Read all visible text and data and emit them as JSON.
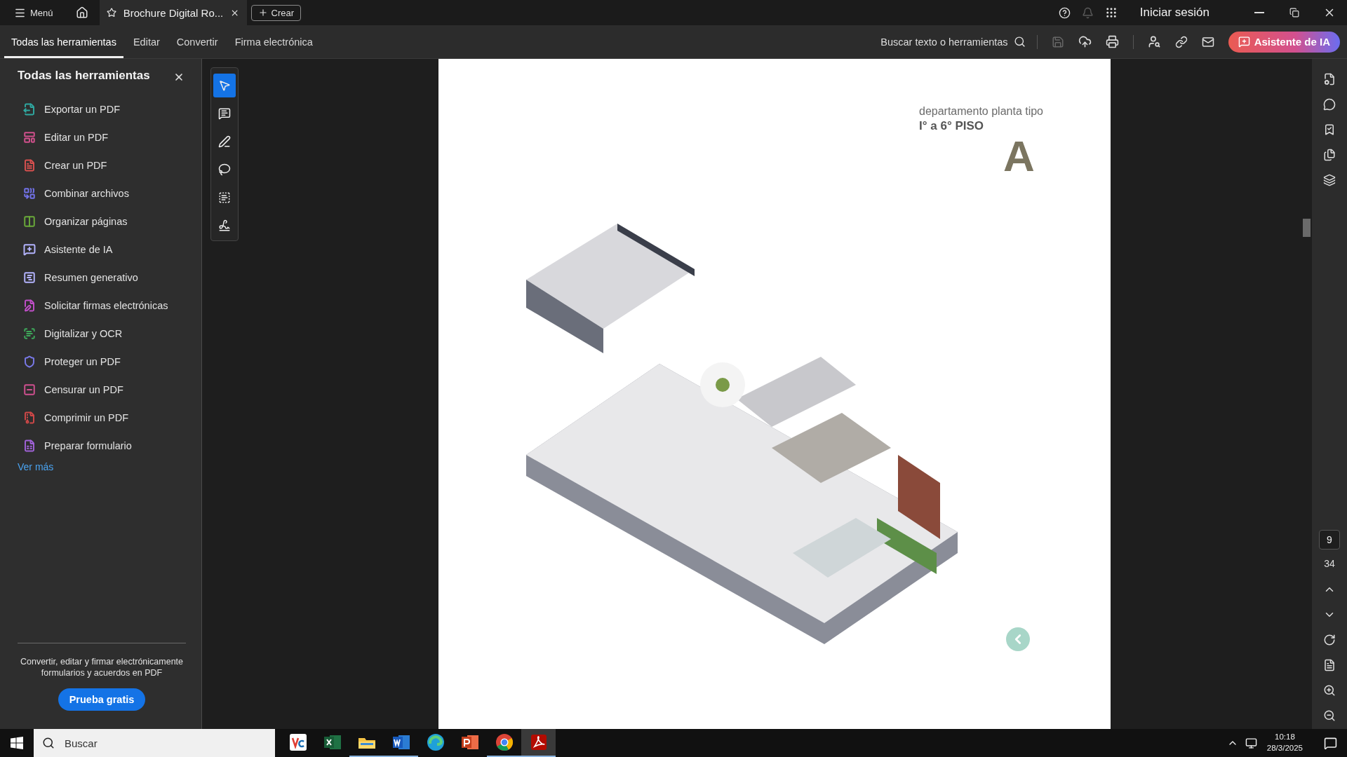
{
  "title_bar": {
    "menu_label": "Menú",
    "document_tab": {
      "title": "Brochure Digital Ro...",
      "selected": true
    },
    "create_button": "Crear",
    "sign_in": "Iniciar sesión",
    "notifications_disabled": true
  },
  "menu_bar": {
    "tabs": [
      {
        "label": "Todas las herramientas",
        "selected": true
      },
      {
        "label": "Editar",
        "selected": false
      },
      {
        "label": "Convertir",
        "selected": false
      },
      {
        "label": "Firma electrónica",
        "selected": false
      }
    ],
    "search_label": "Buscar texto o herramientas",
    "save_disabled": true,
    "ai_button": "Asistente de IA"
  },
  "sidebar": {
    "title": "Todas las herramientas",
    "items": [
      {
        "label": "Exportar un PDF",
        "color": "#2fa7a0"
      },
      {
        "label": "Editar un PDF",
        "color": "#d0508c"
      },
      {
        "label": "Crear un PDF",
        "color": "#d8504f"
      },
      {
        "label": "Combinar archivos",
        "color": "#7272e8"
      },
      {
        "label": "Organizar páginas",
        "color": "#6aaa3a"
      },
      {
        "label": "Asistente de IA",
        "color": "#b4b4ff"
      },
      {
        "label": "Resumen generativo",
        "color": "#b4b4ff"
      },
      {
        "label": "Solicitar firmas electrónicas",
        "color": "#c04fc8"
      },
      {
        "label": "Digitalizar y OCR",
        "color": "#3ea85a"
      },
      {
        "label": "Proteger un PDF",
        "color": "#7979e8"
      },
      {
        "label": "Censurar un PDF",
        "color": "#d05090"
      },
      {
        "label": "Comprimir un PDF",
        "color": "#d04848"
      },
      {
        "label": "Preparar formulario",
        "color": "#a062d8"
      }
    ],
    "more_link": "Ver más",
    "promo_text": "Convertir, editar y firmar electrónicamente formularios y acuerdos en PDF",
    "promo_button": "Prueba gratis"
  },
  "tool_strip": [
    {
      "kind": "select",
      "selected": true
    },
    {
      "kind": "comment",
      "selected": false
    },
    {
      "kind": "pen",
      "selected": false
    },
    {
      "kind": "lasso",
      "selected": false
    },
    {
      "kind": "text",
      "selected": false
    },
    {
      "kind": "sign",
      "selected": false
    }
  ],
  "page": {
    "subtitle": "departamento planta tipo",
    "floors": "I° a 6° PISO",
    "unit": "A"
  },
  "page_nav": {
    "current_page": "9",
    "total_pages": "34"
  },
  "taskbar": {
    "search_placeholder": "Buscar",
    "apps": [
      {
        "kind": "vnc",
        "selected": false,
        "running": false
      },
      {
        "kind": "excel",
        "selected": false,
        "running": false
      },
      {
        "kind": "files",
        "selected": false,
        "running": true
      },
      {
        "kind": "word",
        "selected": false,
        "running": true
      },
      {
        "kind": "edge",
        "selected": false,
        "running": false
      },
      {
        "kind": "powerpoint",
        "selected": false,
        "running": false
      },
      {
        "kind": "chrome",
        "selected": false,
        "running": true
      },
      {
        "kind": "acrobat",
        "selected": true,
        "running": true
      }
    ],
    "time": "10:18",
    "date": "28/3/2025"
  }
}
